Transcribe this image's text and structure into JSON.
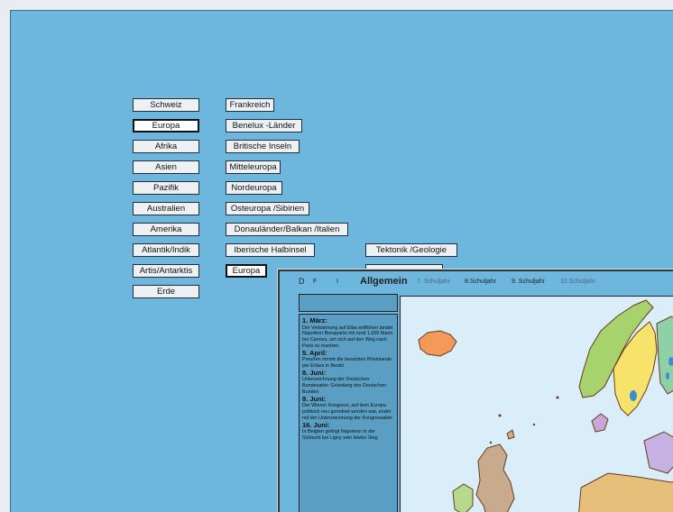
{
  "regions": [
    "Schweiz",
    "Europa",
    "Afrika",
    "Asien",
    "Pazifik",
    "Australien",
    "Amerika",
    "Atlantik/Indik",
    "Artis/Antarktis",
    "Erde"
  ],
  "subregions": [
    "Frankreich",
    "Benelux -Länder",
    "Britische Inseln",
    "Mitteleuropa",
    "Nordeuropa",
    "Osteuropa /Sibirien",
    "Donauländer/Balkan /Italien",
    "Iberische Halbinsel",
    "Europa"
  ],
  "topic_buttons": [
    "Tektonik /Geologie"
  ],
  "panel_tabs": {
    "lang_d": "D",
    "lang_f": "F",
    "lang_i": "I",
    "general": "Allgemein",
    "grade7": "7. Schuljahr",
    "grade8": "8.Schuljahr",
    "grade9": "9. Schuljahr",
    "grade10": "10 Schuljahr"
  },
  "timeline": [
    {
      "date": "1. März:",
      "text": "Der Verbannung auf Elba entflohen landet Napoléon Bonaparte mit rund 1.000 Mann bei Cannes, um sich auf den Weg nach Paris zu machen."
    },
    {
      "date": "5. April:",
      "text": "Preußen nimmt die besetzten Rheinlande per Erlass in Besitz"
    },
    {
      "date": "8. Juni:",
      "text": "Unterzeichnung der Deutschen Bundesakte: Gründung des Deutschen Bundes"
    },
    {
      "date": "9. Juni:",
      "text": "Der Wiener Kongress, auf dem Europa politisch neu geordnet worden war, endet mit der Unterzeichnung der Kongressakte."
    },
    {
      "date": "16. Juni:",
      "text": "In Belgien gelingt Napoleon in der Schlacht bei Ligny sein letzter Sieg"
    }
  ],
  "colors": {
    "background": "#6db6de",
    "button": "#eef1f4",
    "sea": "#d9eef8"
  }
}
